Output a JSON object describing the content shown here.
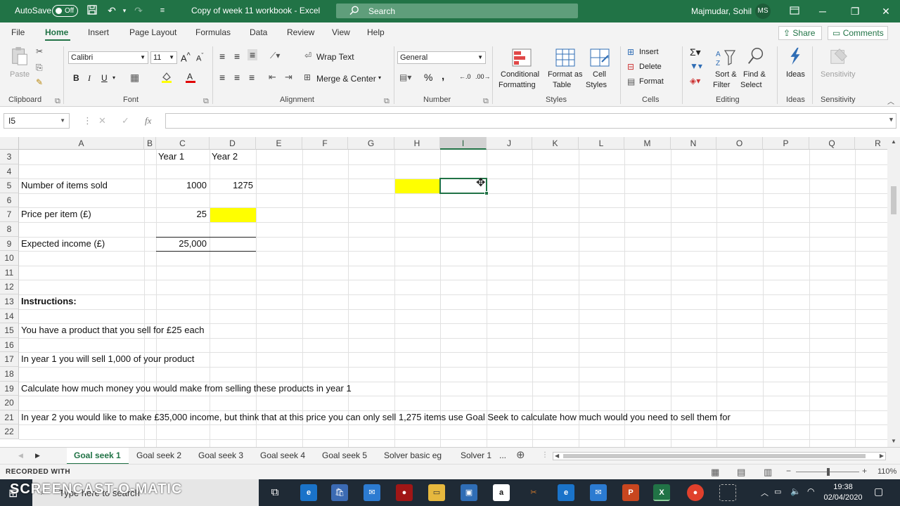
{
  "titlebar": {
    "autosave_label": "AutoSave",
    "autosave_state": "Off",
    "document_title": "Copy of week 11 workbook  -  Excel",
    "search_placeholder": "Search",
    "user_name": "Majmudar, Sohil",
    "user_initials": "MS"
  },
  "ribbon_tabs": [
    "File",
    "Home",
    "Insert",
    "Page Layout",
    "Formulas",
    "Data",
    "Review",
    "View",
    "Help"
  ],
  "share_label": "Share",
  "comments_label": "Comments",
  "ribbon": {
    "clipboard": {
      "label": "Clipboard",
      "paste": "Paste"
    },
    "font": {
      "label": "Font",
      "name": "Calibri",
      "size": "11"
    },
    "alignment": {
      "label": "Alignment",
      "wrap_text": "Wrap Text",
      "merge_center": "Merge & Center"
    },
    "number": {
      "label": "Number",
      "format": "General"
    },
    "styles": {
      "label": "Styles",
      "conditional_1": "Conditional",
      "conditional_2": "Formatting",
      "format_table_1": "Format as",
      "format_table_2": "Table",
      "cell_styles_1": "Cell",
      "cell_styles_2": "Styles"
    },
    "cells": {
      "label": "Cells",
      "insert": "Insert",
      "delete": "Delete",
      "format": "Format"
    },
    "editing": {
      "label": "Editing",
      "sort_1": "Sort &",
      "sort_2": "Filter",
      "find_1": "Find &",
      "find_2": "Select"
    },
    "ideas": {
      "label": "Ideas",
      "button": "Ideas"
    },
    "sensitivity": {
      "label": "Sensitivity",
      "button": "Sensitivity"
    }
  },
  "formula_bar": {
    "name_box": "I5",
    "fx": "fx",
    "value": ""
  },
  "columns": [
    "A",
    "B",
    "C",
    "D",
    "E",
    "F",
    "G",
    "H",
    "I",
    "J",
    "K",
    "L",
    "M",
    "N",
    "O",
    "P",
    "Q",
    "R"
  ],
  "rows": [
    "3",
    "4",
    "5",
    "6",
    "7",
    "8",
    "9",
    "10",
    "11",
    "12",
    "13",
    "14",
    "15",
    "16",
    "17",
    "18",
    "19",
    "20",
    "21",
    "22"
  ],
  "cells": {
    "c3": "Year 1",
    "d3": "Year 2",
    "a5": "Number of items sold",
    "c5": "1000",
    "d5": "1275",
    "a7": "Price per item (£)",
    "c7": "25",
    "a9": "Expected income (£)",
    "c9": "25,000",
    "a13": "Instructions:",
    "a15": "You have a product that you sell for £25 each",
    "a17": "In year 1 you will sell 1,000 of your product",
    "a19": "Calculate how much money you would make from selling these products in year 1",
    "a21": "In year 2 you would like to make £35,000 income, but think that at this price you can only sell 1,275 items use Goal Seek to calculate how much would you need to sell them for"
  },
  "highlight_color": "#ffff00",
  "accent_color": "#217346",
  "sheet_tabs": [
    "Goal seek 1",
    "Goal seek 2",
    "Goal seek 3",
    "Goal seek 4",
    "Goal seek 5",
    "Solver basic eg",
    "Solver 1",
    "..."
  ],
  "status": {
    "zoom": "110%"
  },
  "watermark": {
    "line1": "RECORDED WITH",
    "line2": "SCREENCAST-O-MATIC"
  },
  "taskbar": {
    "search_placeholder": "Type here to search",
    "time": "19:38",
    "date": "02/04/2020"
  }
}
